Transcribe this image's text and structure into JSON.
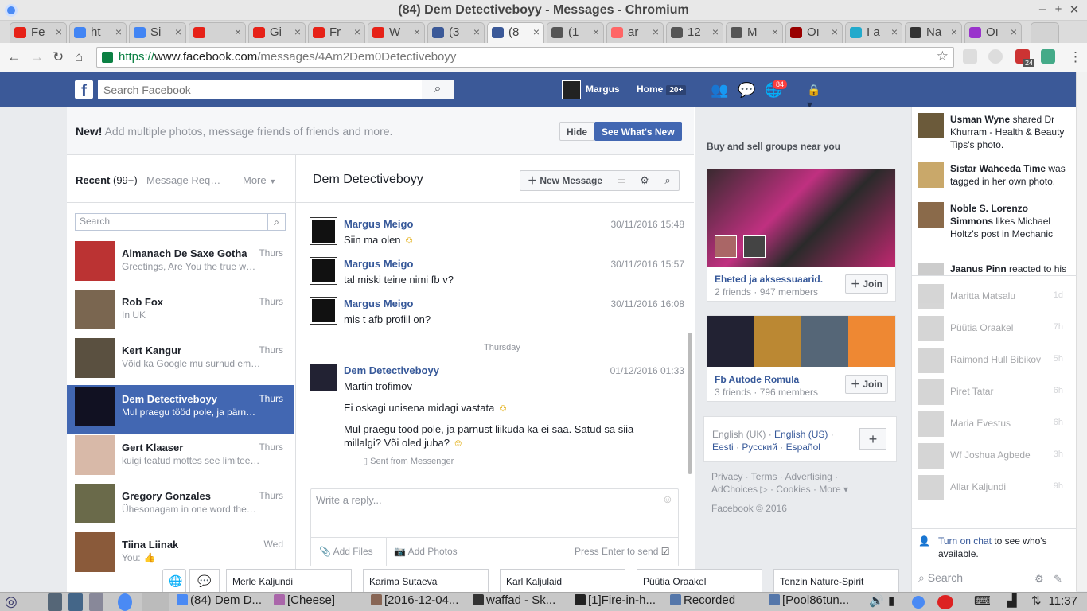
{
  "window": {
    "title": "(84) Dem Detectiveboyy - Messages - Chromium"
  },
  "tabs": [
    {
      "label": "Fe",
      "color": "#e62117"
    },
    {
      "label": "ht",
      "color": "#4285f4"
    },
    {
      "label": "Si",
      "color": "#4285f4"
    },
    {
      "label": "",
      "color": "#e62117"
    },
    {
      "label": "Gi",
      "color": "#e62117"
    },
    {
      "label": "Fr",
      "color": "#e62117"
    },
    {
      "label": "W",
      "color": "#e62117"
    },
    {
      "label": "(3",
      "color": "#3b5998"
    },
    {
      "label": "(8",
      "color": "#3b5998"
    },
    {
      "label": "(1",
      "color": "#555555"
    },
    {
      "label": "ar",
      "color": "#ff6666"
    },
    {
      "label": "12",
      "color": "#555555"
    },
    {
      "label": "M",
      "color": "#555555"
    },
    {
      "label": "Oı",
      "color": "#990000"
    },
    {
      "label": "I a",
      "color": "#22aacc"
    },
    {
      "label": "Na",
      "color": "#333333"
    },
    {
      "label": "Oı",
      "color": "#9933cc"
    }
  ],
  "address": {
    "protocol": "https://",
    "domain": "www.facebook.com",
    "path": "/messages/4Am2Dem0Detectiveboyy",
    "ext_badge": "24"
  },
  "fb": {
    "search_placeholder": "Search Facebook",
    "user": "Margus",
    "home": "Home",
    "home_count": "20+",
    "notif_count": "84"
  },
  "banner": {
    "bold": "New!",
    "text": " Add multiple photos, message friends of friends and more.",
    "hide": "Hide",
    "see_new": "See What's New"
  },
  "left": {
    "recent": "Recent",
    "recent_count": "(99+)",
    "requests": "Message Req…",
    "more": "More",
    "search_placeholder": "Search"
  },
  "conversations": [
    {
      "name": "Almanach De Saxe Gotha",
      "snippet": "Greetings, Are You the true w…",
      "time": "Thurs",
      "color": "#b33"
    },
    {
      "name": "Rob Fox",
      "snippet": "In UK",
      "time": "Thurs",
      "color": "#7a6650"
    },
    {
      "name": "Kert Kangur",
      "snippet": "Võid ka Google mu surnud em…",
      "time": "Thurs",
      "color": "#5a5040"
    },
    {
      "name": "Dem Detectiveboyy",
      "snippet": "Mul praegu tööd pole, ja pärn…",
      "time": "Thurs",
      "color": "#112",
      "selected": true
    },
    {
      "name": "Gert Klaaser",
      "snippet": "kuigi teatud mottes see limitee…",
      "time": "Thurs",
      "color": "#d8b9a8"
    },
    {
      "name": "Gregory Gonzales",
      "snippet": "Ühesonagam in one word the…",
      "time": "Thurs",
      "color": "#6a6a4a"
    },
    {
      "name": "Tiina Liinak",
      "snippet": "You:",
      "time": "Wed",
      "color": "#8a5a3a"
    }
  ],
  "thread": {
    "name": "Dem Detectiveboyy",
    "new_message": "New Message",
    "day": "Thursday",
    "sent_from": "Sent from Messenger",
    "messages": [
      {
        "author": "Margus Meigo",
        "time": "30/11/2016 15:48",
        "lines": [
          "Siin ma olen"
        ]
      },
      {
        "author": "Margus Meigo",
        "time": "30/11/2016 15:57",
        "lines": [
          "tal miski teine nimi fb v?"
        ]
      },
      {
        "author": "Margus Meigo",
        "time": "30/11/2016 16:08",
        "lines": [
          "mis t afb profiil on?"
        ]
      },
      {
        "author": "Dem Detectiveboyy",
        "time": "01/12/2016 01:33",
        "lines": [
          "Martin trofimov",
          "Ei oskagi unisena midagi vastata",
          "Mul praegu tööd pole, ja pärnust liikuda ka ei saa. Satud sa siia millalgi? Või oled juba?"
        ]
      }
    ],
    "reply_placeholder": "Write a reply...",
    "add_files": "Add Files",
    "add_photos": "Add Photos",
    "press_enter": "Press Enter to send"
  },
  "right": {
    "header": "Buy and sell groups near you",
    "groups": [
      {
        "name": "Eheted ja aksessuaarid.",
        "meta": "2 friends · 947 members",
        "join": "Join"
      },
      {
        "name": "Fb Autode Romula",
        "meta": "3 friends · 796 members",
        "join": "Join"
      }
    ],
    "lang_current": "English (UK)",
    "langs": [
      "English (US)",
      "Eesti",
      "Русский",
      "Español"
    ],
    "footer": [
      "Privacy",
      "Terms",
      "Advertising",
      "AdChoices",
      "Cookies",
      "More"
    ],
    "copyright": "Facebook © 2016"
  },
  "ticker": [
    {
      "bold": "Usman Wyne",
      "text": " shared Dr Khurram - Health & Beauty Tips's photo."
    },
    {
      "bold": "Sistar Waheeda Time",
      "text": " was tagged in her own photo."
    },
    {
      "bold": "Noble S. Lorenzo Simmons",
      "text": " likes Michael Holtz's post in Mechanic and Car Memes."
    },
    {
      "bold": "Jaanus Pinn",
      "text": " reacted to his"
    }
  ],
  "chat_contacts": [
    {
      "name": "Maritta Matsalu",
      "time": "1d"
    },
    {
      "name": "Püütia Oraakel",
      "time": "7h"
    },
    {
      "name": "Raimond Hull Bibikov",
      "time": "5h"
    },
    {
      "name": "Piret Tatar",
      "time": "6h"
    },
    {
      "name": "Maria Evestus",
      "time": "6h"
    },
    {
      "name": "Wf Joshua Agbede",
      "time": "3h"
    },
    {
      "name": "Allar Kaljundi",
      "time": "9h"
    }
  ],
  "chat": {
    "turn_on": "Turn on chat",
    "turn_on_rest": " to see who's available.",
    "search": "Search"
  },
  "dock": [
    "Merle Kaljundi",
    "Karima Sutaeva",
    "Karl Kaljulaid",
    "Püütia Oraakel",
    "Tenzin Nature-Spirit"
  ],
  "taskbar": {
    "items": [
      "(84) Dem D...",
      "[Cheese]",
      "[2016-12-04...",
      "waffad - Sk...",
      "[1]Fire-in-h...",
      "Recorded",
      "[Pool86tun..."
    ],
    "clock": "11:37"
  }
}
